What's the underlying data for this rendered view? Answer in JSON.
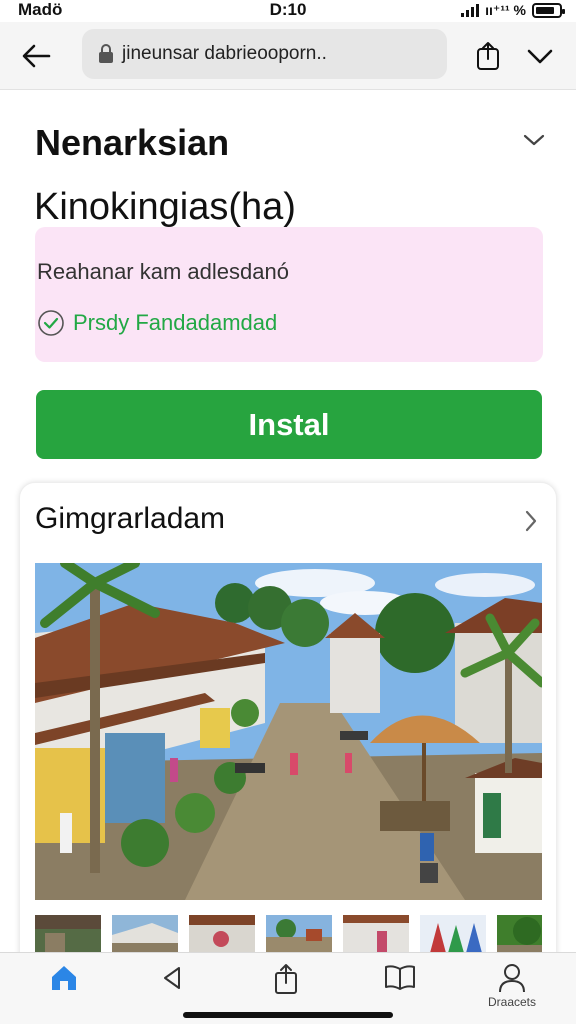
{
  "status_bar": {
    "carrier": "Madö",
    "time": "D:10",
    "signal_text": "ıı⁺¹¹ %"
  },
  "browser": {
    "url": "jineunsar dabrieooporn..",
    "icons": {
      "back": "arrow-left-icon",
      "lock": "lock-icon",
      "share": "share-icon",
      "more": "chevron-down-icon"
    }
  },
  "app": {
    "title": "Nenarksian",
    "subtitle": "Kinokingias(ha)",
    "description": "Reahanar kam adlesdanó",
    "verified_label": "Prsdy Fandadamdad",
    "install_label": "Instal"
  },
  "gallery": {
    "title": "Gimgrarladam",
    "thumbnail_count": 8
  },
  "nav": {
    "items": [
      {
        "icon": "home-icon",
        "label": ""
      },
      {
        "icon": "back-triangle-icon",
        "label": ""
      },
      {
        "icon": "share-icon",
        "label": ""
      },
      {
        "icon": "book-icon",
        "label": ""
      },
      {
        "icon": "person-icon",
        "label": "Draacets"
      }
    ]
  },
  "colors": {
    "accent_green": "#27a43f",
    "verified_green": "#22a845",
    "info_box_pink": "#fbe4f6",
    "nav_active_blue": "#2b86e6"
  }
}
